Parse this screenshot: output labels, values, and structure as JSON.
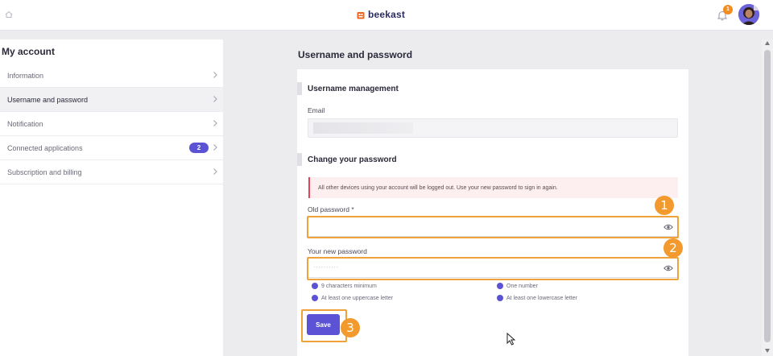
{
  "topbar": {
    "brand": "beekast",
    "notification_count": "1",
    "icons": {
      "home": "home-icon",
      "bell": "bell-icon",
      "avatar": "user-avatar"
    },
    "colors": {
      "brand_orange": "#f26522",
      "brand_text": "#2c2c62",
      "badge": "#f28c1e"
    }
  },
  "sidebar": {
    "title": "My account",
    "items": [
      {
        "label": "Information"
      },
      {
        "label": "Username and password",
        "active": true
      },
      {
        "label": "Notification"
      },
      {
        "label": "Connected applications",
        "badge": "2"
      },
      {
        "label": "Subscription and billing"
      }
    ]
  },
  "main": {
    "page_title": "Username and password",
    "username_section": {
      "heading": "Username management",
      "email_label": "Email"
    },
    "password_section": {
      "heading": "Change your password",
      "notice": "All other devices using your account will be logged out. Use your new password to sign in again.",
      "old_password_label": "Old password *",
      "old_password_value": "",
      "new_password_label": "Your new password",
      "new_password_masked": "··········",
      "rules": [
        "9 characters minimum",
        "One number",
        "At least one uppercase letter",
        "At least one lowercase letter"
      ]
    },
    "save_label": "Save"
  },
  "annotations": {
    "steps": [
      "1",
      "2",
      "3"
    ],
    "highlight_color": "#f0a23a",
    "step_color": "#f29a2e"
  },
  "theme": {
    "accent": "#5b52d6",
    "notice_border": "#e0435a",
    "notice_bg": "#fdeff0"
  }
}
